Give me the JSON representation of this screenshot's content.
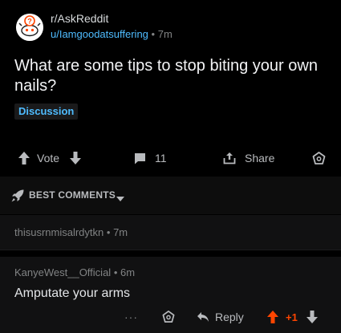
{
  "post": {
    "subreddit": "r/AskReddit",
    "author": "u/Iamgoodatsuffering",
    "separator": "•",
    "time": "7m",
    "title": "What are some tips to stop biting your own nails?",
    "flair": "Discussion"
  },
  "actions": {
    "vote_label": "Vote",
    "comment_count": "11",
    "share_label": "Share"
  },
  "sort": {
    "label": "BEST COMMENTS"
  },
  "comments": [
    {
      "author": "thisusrnmisalrdytkn",
      "time": "7m",
      "collapsed": true
    },
    {
      "author": "KanyeWest__Official",
      "time": "6m",
      "body": "Amputate your arms",
      "more_label": "···",
      "reply_label": "Reply",
      "score": "+1"
    }
  ],
  "colors": {
    "background": "#000000",
    "link_blue": "#4fbcff",
    "upvote_orange": "#ff4500",
    "text_muted": "#818384"
  }
}
